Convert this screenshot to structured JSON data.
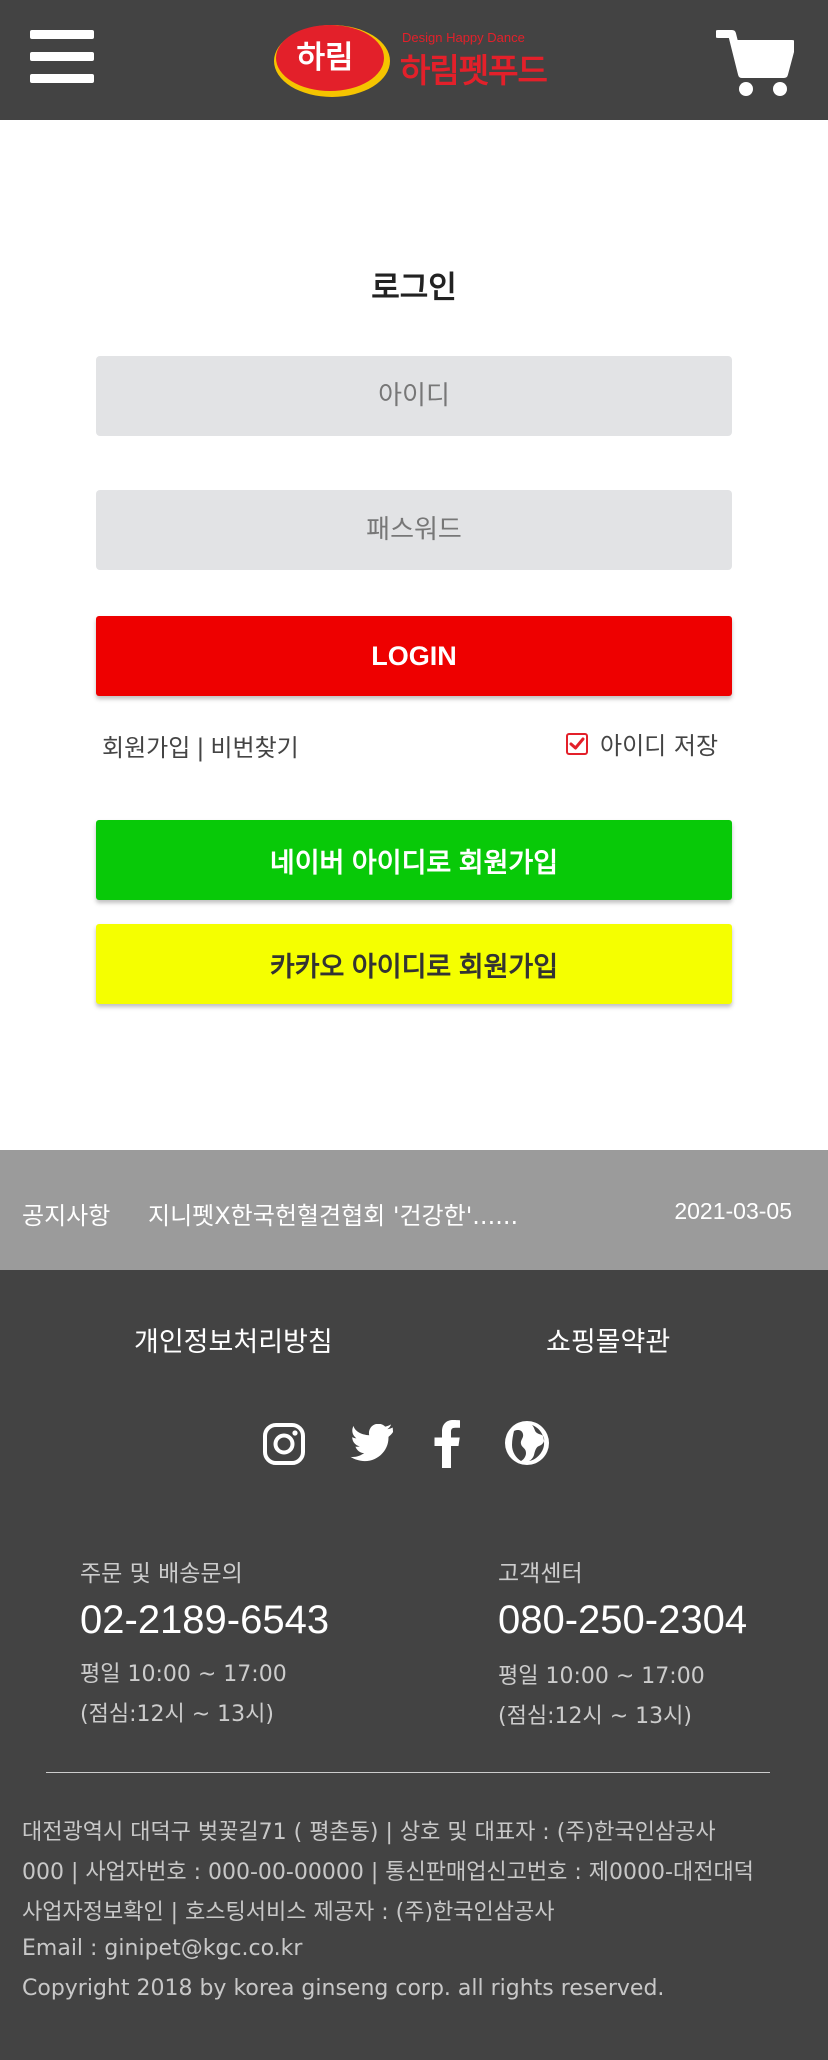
{
  "header": {
    "logo_badge": "하림",
    "logo_tagline": "Design Happy Dance",
    "logo_name": "하림펫푸드"
  },
  "login": {
    "title": "로그인",
    "id_placeholder": "아이디",
    "password_placeholder": "패스워드",
    "login_button": "LOGIN",
    "signup_link": "회원가입",
    "link_separator": "|",
    "find_password_link": "비번찾기",
    "remember_label": "아이디 저장",
    "remember_checked": true,
    "naver_button": "네이버 아이디로 회원가입",
    "kakao_button": "카카오 아이디로 회원가입"
  },
  "notice": {
    "label": "공지사항",
    "title": "지니펫X한국헌혈견협회 '건강한'......",
    "date": "2021-03-05"
  },
  "footer": {
    "privacy_link": "개인정보처리방침",
    "terms_link": "쇼핑몰약관",
    "social_icons": [
      "instagram-icon",
      "twitter-icon",
      "facebook-icon",
      "globe-icon"
    ],
    "order_label": "주문 및 배송문의",
    "order_phone": "02-2189-6543",
    "order_hours": "평일 10:00 ~ 17:00",
    "order_lunch": "(점심:12시 ~ 13시)",
    "cs_label": "고객센터",
    "cs_phone": "080-250-2304",
    "cs_hours": "평일 10:00 ~ 17:00",
    "cs_lunch": "(점심:12시 ~ 13시)",
    "info_line1": "대전광역시 대덕구 벚꽃길71 ( 평촌동) | 상호 및 대표자 : (주)한국인삼공사",
    "info_line2": "000 | 사업자번호 : 000-00-00000 | 통신판매업신고번호 : 제0000-대전대덕",
    "info_line3": "사업자정보확인 | 호스팅서비스 제공자 : (주)한국인삼공사",
    "email": "Email : ginipet@kgc.co.kr",
    "copyright": "Copyright    2018 by korea ginseng corp. all rights reserved."
  },
  "colors": {
    "header_bg": "#434343",
    "login_red": "#ee0000",
    "naver_green": "#08c908",
    "kakao_yellow": "#f5ff00",
    "field_bg": "#e2e3e5",
    "notice_bg": "#9b9b9b",
    "brand_red": "#e3202a"
  }
}
